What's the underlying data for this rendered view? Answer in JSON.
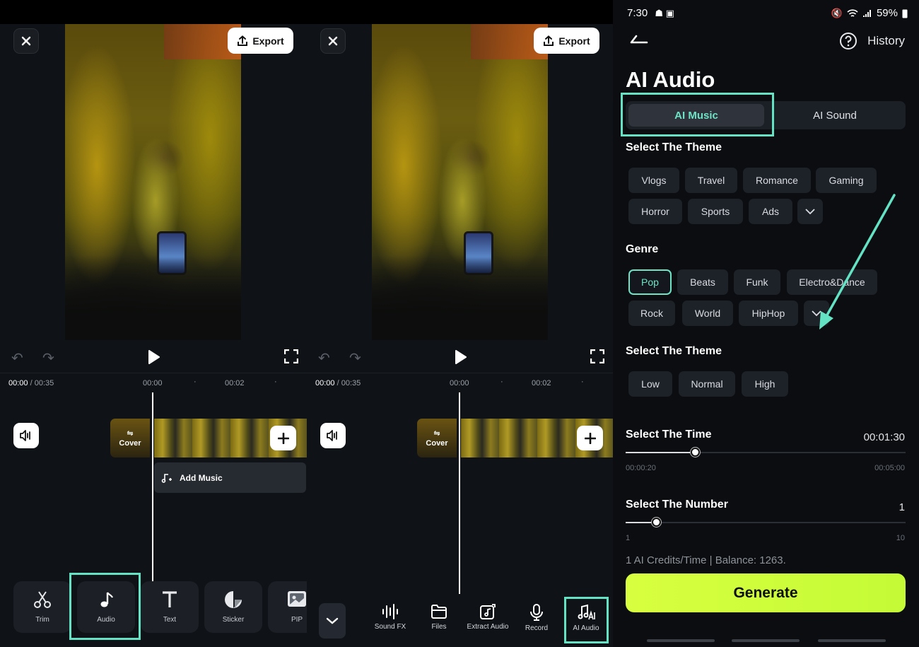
{
  "left_editor": {
    "close_label": "✕",
    "export_label": "Export",
    "current_time": "00:00",
    "total_time": "/ 00:35",
    "ruler_ticks": [
      "00:00",
      "00:02"
    ],
    "cover_label": "Cover",
    "add_music_label": "Add Music",
    "tools": [
      {
        "label": "Trim",
        "icon": "scissors-icon"
      },
      {
        "label": "Audio",
        "icon": "music-note-icon"
      },
      {
        "label": "Text",
        "icon": "text-icon"
      },
      {
        "label": "Sticker",
        "icon": "sticker-icon"
      },
      {
        "label": "PIP",
        "icon": "pip-icon"
      }
    ]
  },
  "middle_editor": {
    "export_label": "Export",
    "current_time": "00:00",
    "total_time": "/ 00:35",
    "ruler_ticks": [
      "00:00",
      "00:02"
    ],
    "cover_label": "Cover",
    "audio_tools": [
      {
        "label": "Sound FX",
        "icon": "waveform-icon"
      },
      {
        "label": "Files",
        "icon": "folder-icon"
      },
      {
        "label": "Extract Audio",
        "icon": "extract-audio-icon"
      },
      {
        "label": "Record",
        "icon": "microphone-icon"
      },
      {
        "label": "AI Audio",
        "icon": "ai-music-icon"
      }
    ]
  },
  "ai_audio": {
    "status": {
      "time": "7:30",
      "battery": "59%"
    },
    "history_label": "History",
    "title": "AI Audio",
    "tabs": [
      "AI Music",
      "AI Sound"
    ],
    "theme_heading": "Select The Theme",
    "themes": [
      "Vlogs",
      "Travel",
      "Romance",
      "Gaming",
      "Horror",
      "Sports",
      "Ads"
    ],
    "genre_heading": "Genre",
    "genres": [
      "Pop",
      "Beats",
      "Funk",
      "Electro&Dance",
      "Rock",
      "World",
      "HipHop"
    ],
    "selected_genre": "Pop",
    "level_heading": "Select The Theme",
    "levels": [
      "Low",
      "Normal",
      "High"
    ],
    "time_heading": "Select The Time",
    "time_value": "00:01:30",
    "time_min": "00:00:20",
    "time_max": "00:05:00",
    "time_fraction": 0.25,
    "number_heading": "Select The Number",
    "number_value": "1",
    "number_min": "1",
    "number_max": "10",
    "number_fraction": 0.11,
    "credits_text": "1 AI Credits/Time | Balance: 1263.",
    "generate_label": "Generate"
  },
  "colors": {
    "highlight": "#64e3c4",
    "accent": "#6ee3c6",
    "generate": "#d8ff3f",
    "background": "#0f1217"
  }
}
